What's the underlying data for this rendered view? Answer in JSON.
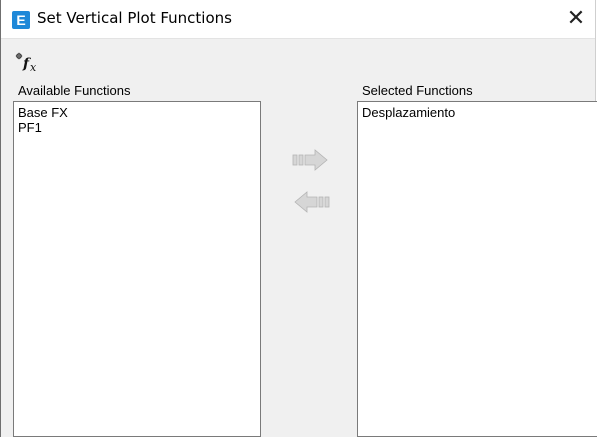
{
  "window": {
    "title": "Set Vertical Plot Functions",
    "app_icon_letter": "E",
    "close_glyph": "✕"
  },
  "toolbar": {
    "function_button_icon": "function-fx-icon"
  },
  "available": {
    "label": "Available Functions",
    "items": [
      "Base FX",
      "PF1"
    ]
  },
  "selected": {
    "label": "Selected Functions",
    "items": [
      "Desplazamiento"
    ]
  },
  "buttons": {
    "add_icon": "arrow-right-icon",
    "remove_icon": "arrow-left-icon"
  },
  "colors": {
    "app_icon": "#1e88d8",
    "dialog_background": "#f0f0f0",
    "disabled_arrow": "#c8c8c8"
  }
}
